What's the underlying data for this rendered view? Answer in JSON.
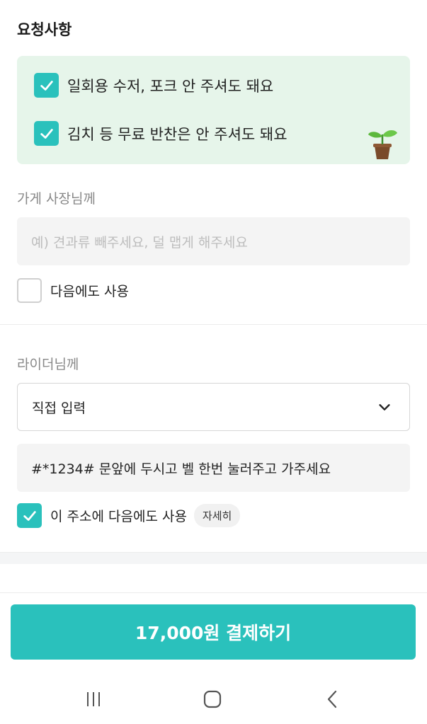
{
  "request": {
    "section_title": "요청사항",
    "eco_options": [
      {
        "label": "일회용 수저, 포크 안 주셔도 돼요",
        "checked": true
      },
      {
        "label": "김치 등 무료 반찬은 안 주셔도 돼요",
        "checked": true
      }
    ]
  },
  "store": {
    "label": "가게 사장님께",
    "placeholder": "예) 견과류 빼주세요, 덜 맵게 해주세요",
    "reuse_label": "다음에도 사용",
    "reuse_checked": false
  },
  "rider": {
    "label": "라이더님께",
    "select_value": "직접 입력",
    "message": "#*1234# 문앞에 두시고 벨 한번 눌러주고 가주세요",
    "reuse_label": "이 주소에 다음에도 사용",
    "reuse_checked": true,
    "detail_chip": "자세히"
  },
  "pay": {
    "button_label": "17,000원 결제하기"
  },
  "colors": {
    "accent": "#2ac1bc",
    "eco_bg": "#e6f5ea"
  },
  "icons": [
    "check-icon",
    "plant-icon",
    "chevron-down-icon",
    "recent-apps-icon",
    "home-icon",
    "back-icon"
  ]
}
